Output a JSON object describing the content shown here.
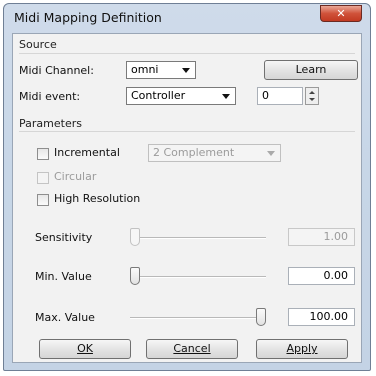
{
  "window": {
    "title": "Midi Mapping Definition",
    "close_glyph": "✕"
  },
  "source": {
    "label": "Source",
    "midi_channel": {
      "label": "Midi Channel:",
      "value": "omni"
    },
    "learn_label": "Learn",
    "midi_event": {
      "label": "Midi event:",
      "value": "Controller",
      "number": "0"
    }
  },
  "parameters": {
    "label": "Parameters",
    "incremental": {
      "label": "Incremental",
      "checked": false,
      "mode": "2 Complement"
    },
    "circular": {
      "label": "Circular",
      "checked": false,
      "enabled": false
    },
    "high_resolution": {
      "label": "High Resolution",
      "checked": false
    }
  },
  "sliders": {
    "sensitivity": {
      "label": "Sensitivity",
      "value": "1.00",
      "position": 0.0,
      "enabled": false
    },
    "min_value": {
      "label": "Min. Value",
      "value": "0.00",
      "position": 0.0
    },
    "max_value": {
      "label": "Max. Value",
      "value": "100.00",
      "position": 1.0
    }
  },
  "buttons": {
    "ok": "OK",
    "cancel": "Cancel",
    "apply": "Apply"
  }
}
